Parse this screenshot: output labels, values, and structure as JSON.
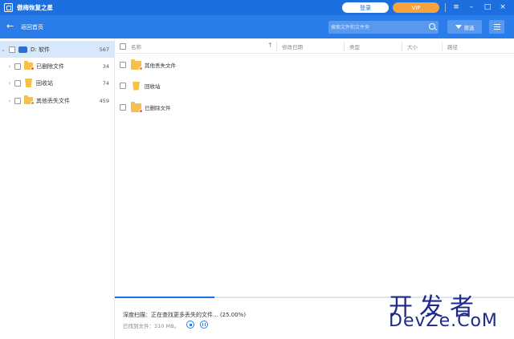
{
  "app": {
    "title": "傲梅恢复之星",
    "login_label": "登录",
    "vip_label": "VIP"
  },
  "window_controls": {
    "menu": "≡",
    "minimize": "–",
    "maximize": "□",
    "close": "×"
  },
  "nav": {
    "back_label": "返回首页",
    "search_placeholder": "搜索文件和文件夹",
    "filter_label": "筛选"
  },
  "sidebar": {
    "items": [
      {
        "label": "D: 软件",
        "count": "567",
        "icon": "drive-icon",
        "selected": true,
        "expanded": true
      },
      {
        "label": "已删除文件",
        "count": "34",
        "icon": "deleted-folder-icon"
      },
      {
        "label": "回收站",
        "count": "74",
        "icon": "recycle-bin-icon"
      },
      {
        "label": "其他丢失文件",
        "count": "459",
        "icon": "lost-folder-icon"
      }
    ]
  },
  "table": {
    "columns": [
      "名称",
      "修改日期",
      "类型",
      "大小",
      "路径"
    ],
    "rows": [
      {
        "name": "其他丢失文件",
        "icon": "lost-folder-icon"
      },
      {
        "name": "回收站",
        "icon": "recycle-bin-icon"
      },
      {
        "name": "已删除文件",
        "icon": "deleted-folder-icon"
      }
    ]
  },
  "status": {
    "scan_text": "深度扫描：正在查找更多丢失的文件... (25.00%)",
    "found_text": "已找到文件：310 MB。",
    "progress": 0.25
  },
  "watermark": {
    "cn": "开发者",
    "en": "DevZe.CoM"
  },
  "colors": {
    "primary": "#1d6fe0",
    "vip": "#f7a23b",
    "selected_row": "#d8e8fc"
  }
}
